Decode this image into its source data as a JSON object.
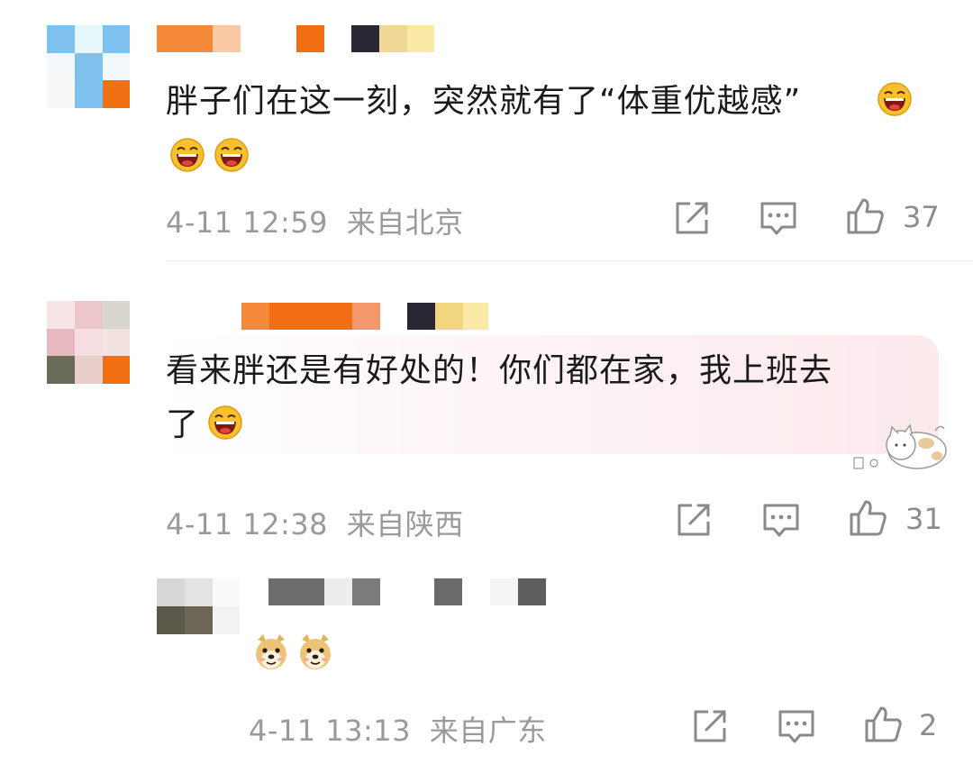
{
  "comments": [
    {
      "text_line1": "胖子们在这一刻，突然就有了“体重优越感”",
      "timestamp": "4-11 12:59",
      "location": "来自北京",
      "like_count": "37"
    },
    {
      "text_line1": "看来胖还是有好处的！你们都在家，我上班去",
      "text_line2": "了",
      "timestamp": "4-11 12:38",
      "location": "来自陕西",
      "like_count": "31"
    },
    {
      "timestamp": "4-11 13:13",
      "location": "来自广东",
      "like_count": "2"
    }
  ],
  "icons": {
    "share": "share-icon",
    "reply": "comment-icon",
    "like": "thumbs-up-icon",
    "emoji_laugh": "laughing-emoji-icon",
    "emoji_doge": "doge-emoji-icon"
  },
  "colors": {
    "text": "#1a1a1a",
    "meta": "#9a9a9a",
    "bubble": "#fbe9ec"
  }
}
